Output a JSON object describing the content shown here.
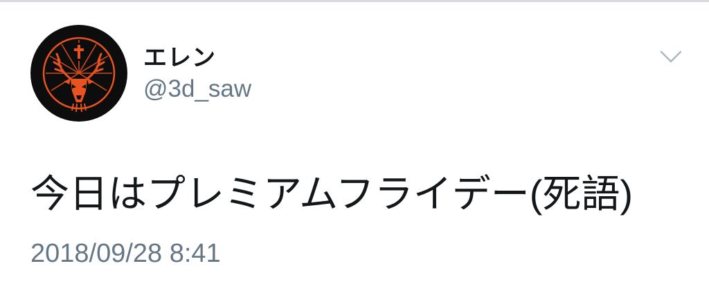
{
  "tweet": {
    "author": {
      "display_name": "エレン",
      "handle": "@3d_saw"
    },
    "text": "今日はプレミアムフライデー(死語)",
    "timestamp": "2018/09/28 8:41"
  },
  "icons": {
    "avatar": "stag-with-cross-logo",
    "menu": "chevron-down-icon"
  },
  "colors": {
    "avatar_accent": "#e8531f",
    "avatar_background": "#0d0d0d",
    "text_primary": "#14171a",
    "text_secondary": "#657786",
    "chevron": "#aab8c2"
  }
}
